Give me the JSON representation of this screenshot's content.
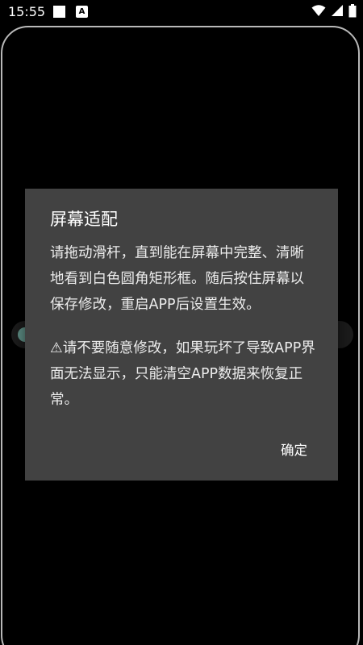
{
  "status_bar": {
    "time": "15:55",
    "icons": [
      "notification-square-icon",
      "notification-a-icon",
      "wifi-icon",
      "signal-icon",
      "battery-icon"
    ],
    "notif_letter": "A"
  },
  "dialog": {
    "title": "屏幕适配",
    "message": "请拖动滑杆，直到能在屏幕中完整、清晰地看到白色圆角矩形框。随后按住屏幕以保存修改，重启APP后设置生效。",
    "warning": "⚠请不要随意修改，如果玩坏了导致APP界面无法显示，只能清空APP数据来恢复正常。",
    "confirm_label": "确定"
  },
  "colors": {
    "background": "#000000",
    "dialog": "#424242",
    "frame": "#b9b9b9",
    "slider_thumb": "#5f8f86"
  }
}
